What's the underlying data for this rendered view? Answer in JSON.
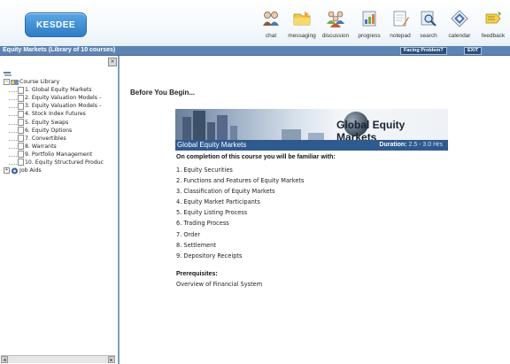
{
  "brand": {
    "logo_text": "KESDEE"
  },
  "toolbar": [
    {
      "label": "chat",
      "icon": "chat-icon"
    },
    {
      "label": "messaging",
      "icon": "folder-icon"
    },
    {
      "label": "discussion",
      "icon": "discussion-icon"
    },
    {
      "label": "progress",
      "icon": "progress-icon"
    },
    {
      "label": "notepad",
      "icon": "notepad-icon"
    },
    {
      "label": "search",
      "icon": "search-icon"
    },
    {
      "label": "calendar",
      "icon": "calendar-icon"
    },
    {
      "label": "feedback",
      "icon": "feedback-icon"
    }
  ],
  "titlebar": {
    "title": "Equity Markets (Library of 10 courses)",
    "facing_problem": "Facing Problem?",
    "exit": "EXIT"
  },
  "tree": {
    "root_label": "Course Library",
    "courses": [
      "1. Global Equity Markets",
      "2. Equity Valuation Models -",
      "3. Equity Valuation Models -",
      "4. Stock Index Futures",
      "5. Equity Swaps",
      "6. Equity Options",
      "7. Convertibles",
      "8. Warrants",
      "9. Portfolio Management",
      "10. Equity Structured Produc"
    ],
    "job_aids_label": "Job Aids"
  },
  "main": {
    "heading": "Before You Begin...",
    "banner": {
      "title": "Global Equity Markets",
      "bar_title": "Global Equity Markets",
      "duration_label": "Duration:",
      "duration_value": "2.5 - 3.0 Hrs"
    },
    "intro": "On completion of this course you will be familiar with:",
    "topics": [
      "1. Equity Securities",
      "2. Functions and Features of Equity Markets",
      "3. Classification of Equity Markets",
      "4. Equity Market Participants",
      "5. Equity Listing Process",
      "6. Trading Process",
      "7. Order",
      "8. Settlement",
      "9. Depository Receipts"
    ],
    "prereq_heading": "Prerequisites:",
    "prereq_text": "Overview of Financial System"
  },
  "colors": {
    "titlebar": "#5e84b4",
    "banner_bar": "#2f5a8e",
    "logo": "#3b8ad6"
  }
}
